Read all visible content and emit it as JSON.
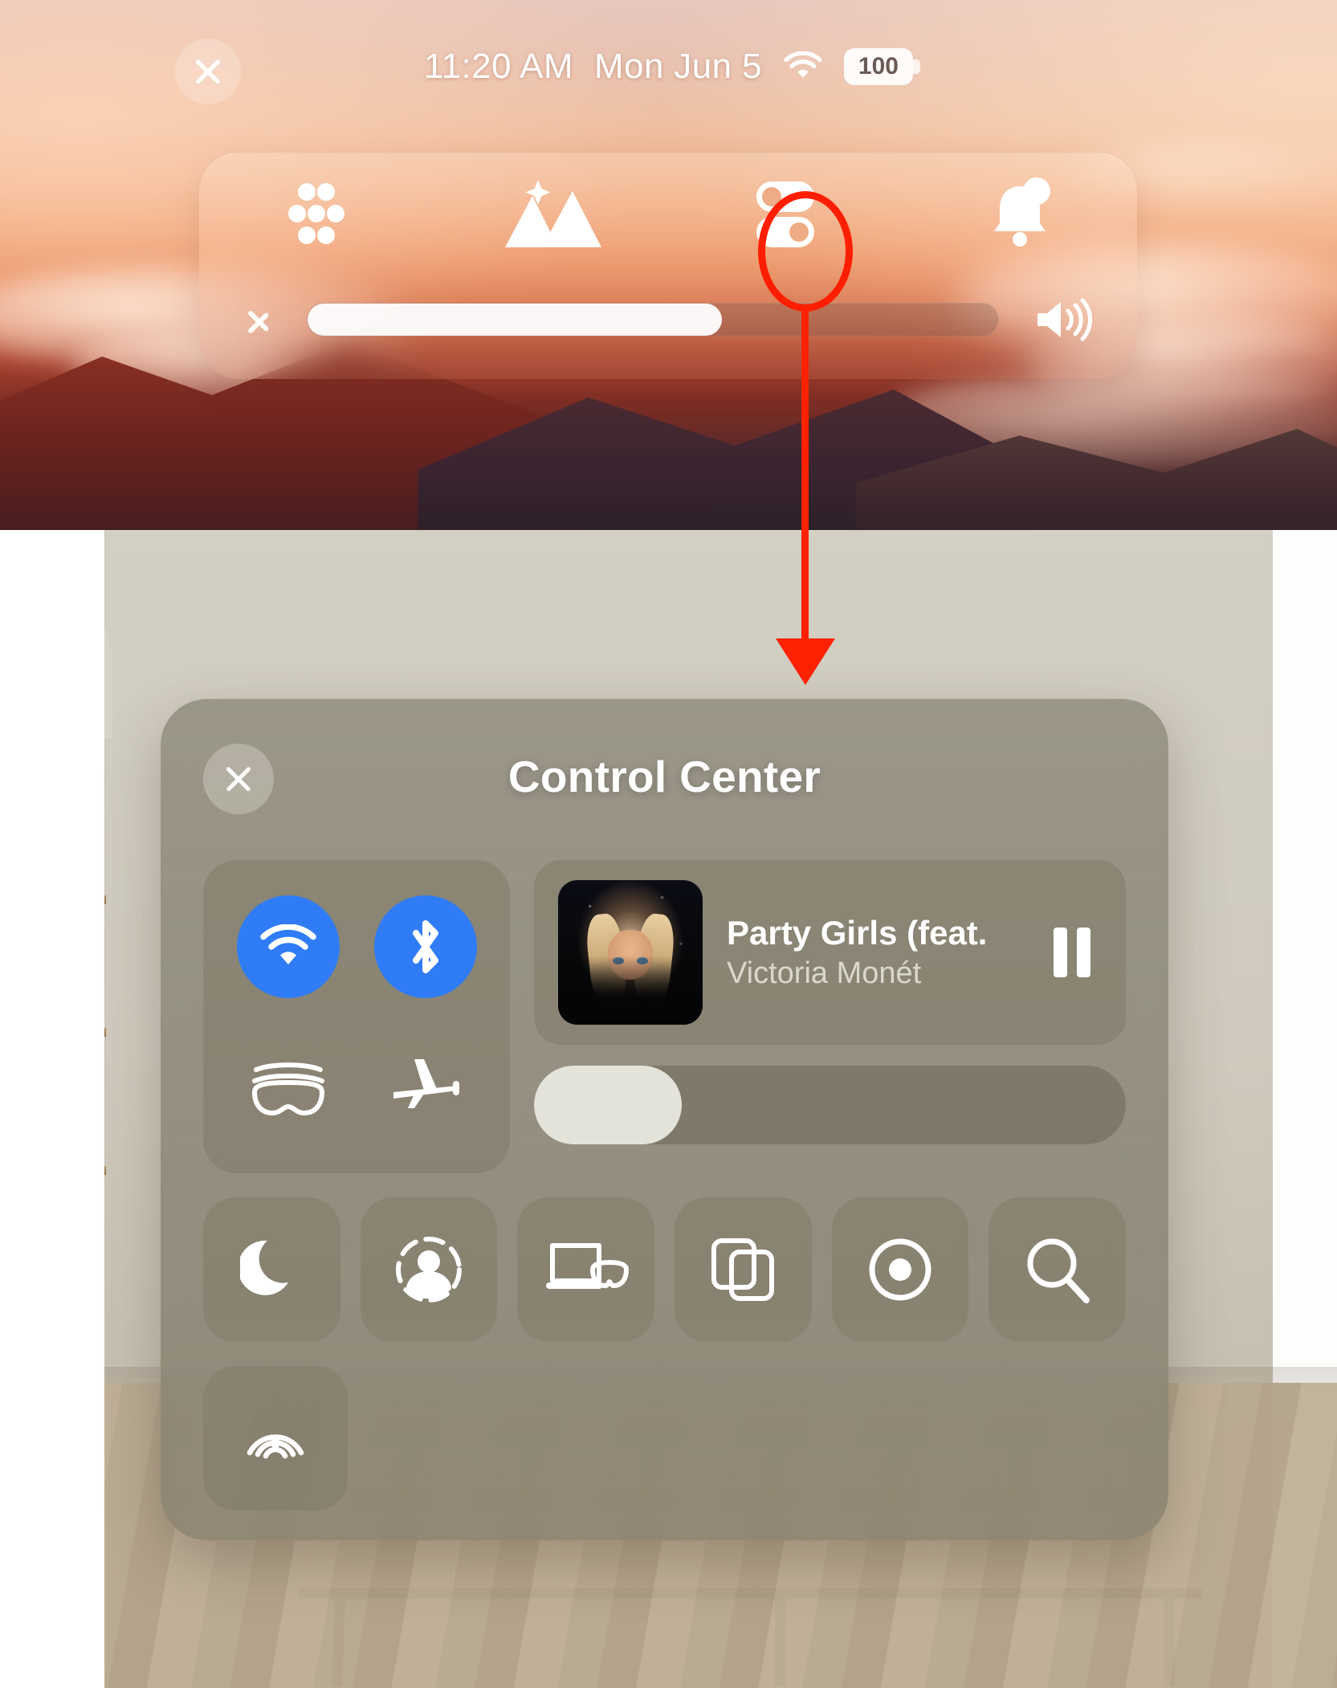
{
  "status_bar": {
    "close_label": "close",
    "time": "11:20 AM",
    "date": "Mon Jun 5",
    "wifi_icon": "wifi-icon",
    "battery_percent": "100"
  },
  "top_control_bar": {
    "icons": [
      {
        "name": "apps-grid-icon",
        "label": "Home View"
      },
      {
        "name": "environments-mountain-icon",
        "label": "Environments"
      },
      {
        "name": "control-center-toggles-icon",
        "label": "Control Center"
      },
      {
        "name": "notifications-bell-icon",
        "label": "Notifications"
      }
    ],
    "expand_chevron": "chevron-right-icon",
    "volume": {
      "value": 60,
      "icon": "speaker-wave-icon"
    }
  },
  "annotation": {
    "highlight_target": "control-center-toggles-icon",
    "color": "#ff2200",
    "shape": "ellipse-with-down-arrow"
  },
  "control_center": {
    "title": "Control Center",
    "close_label": "close",
    "toggles": [
      {
        "name": "wifi-toggle",
        "label": "Wi-Fi",
        "state": "on",
        "color": "#2f7cf6"
      },
      {
        "name": "bluetooth-toggle",
        "label": "Bluetooth",
        "state": "on",
        "color": "#2f7cf6"
      },
      {
        "name": "vision-pro-toggle",
        "label": "Vision Pro",
        "state": "off",
        "color": "transparent"
      },
      {
        "name": "airplane-mode-toggle",
        "label": "Airplane Mode",
        "state": "off",
        "color": "transparent"
      }
    ],
    "now_playing": {
      "title": "Party Girls (feat.",
      "artist": "Victoria Monét",
      "transport_state": "playing",
      "transport_icon": "pause-icon",
      "artwork_alt": "album-artwork"
    },
    "volume_slider": {
      "value": 25,
      "name": "volume-slider"
    },
    "tiles_row": [
      {
        "name": "do-not-disturb-tile",
        "label": "Do Not Disturb",
        "icon": "moon-icon"
      },
      {
        "name": "persona-tile",
        "label": "Persona",
        "icon": "persona-icon"
      },
      {
        "name": "mac-virtual-display-tile",
        "label": "Mac Virtual Display",
        "icon": "mac-virtual-display-icon"
      },
      {
        "name": "window-mirroring-tile",
        "label": "Mirroring",
        "icon": "window-mirroring-icon"
      },
      {
        "name": "screen-record-tile",
        "label": "Record",
        "icon": "screen-record-icon"
      },
      {
        "name": "search-tile",
        "label": "Search",
        "icon": "search-icon"
      }
    ],
    "tiles_row_2": [
      {
        "name": "airdrop-tile",
        "label": "AirDrop",
        "icon": "airdrop-icon"
      }
    ]
  },
  "colors": {
    "accent_blue": "#2f7cf6",
    "annotation_red": "#ff2200",
    "panel_bg": "#8d8879"
  }
}
